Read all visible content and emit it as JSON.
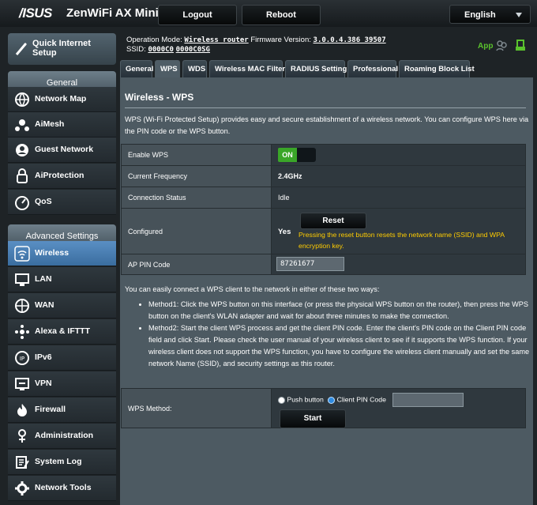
{
  "header": {
    "brand": "/ISUS",
    "model": "ZenWiFi AX Mini",
    "logout_label": "Logout",
    "reboot_label": "Reboot",
    "language": "English",
    "operation_mode_label": "Operation Mode:",
    "operation_mode": "Wireless router",
    "firmware_label": "Firmware Version:",
    "firmware_version": "3.0.0.4.386_39507",
    "ssid_label": "SSID:",
    "ssid_1": "0000C0",
    "ssid_2": "0000C0SG",
    "app_label": "App"
  },
  "sidebar": {
    "qis_label": "Quick Internet Setup",
    "general_head": "General",
    "general_items": [
      {
        "label": "Network Map",
        "icon": "globe-icon"
      },
      {
        "label": "AiMesh",
        "icon": "mesh-icon"
      },
      {
        "label": "Guest Network",
        "icon": "guest-icon"
      },
      {
        "label": "AiProtection",
        "icon": "lock-icon"
      },
      {
        "label": "QoS",
        "icon": "gauge-icon"
      }
    ],
    "advanced_head": "Advanced Settings",
    "advanced_items": [
      {
        "label": "Wireless",
        "icon": "wifi-icon"
      },
      {
        "label": "LAN",
        "icon": "monitor-icon"
      },
      {
        "label": "WAN",
        "icon": "globe-icon"
      },
      {
        "label": "Alexa & IFTTT",
        "icon": "dots-icon"
      },
      {
        "label": "IPv6",
        "icon": "ipv6-icon"
      },
      {
        "label": "VPN",
        "icon": "vpn-icon"
      },
      {
        "label": "Firewall",
        "icon": "fire-icon"
      },
      {
        "label": "Administration",
        "icon": "admin-icon"
      },
      {
        "label": "System Log",
        "icon": "log-icon"
      },
      {
        "label": "Network Tools",
        "icon": "tools-icon"
      }
    ]
  },
  "tabs": [
    "General",
    "WPS",
    "WDS",
    "Wireless MAC Filter",
    "RADIUS Setting",
    "Professional",
    "Roaming Block List"
  ],
  "active_tab": "WPS",
  "page": {
    "title": "Wireless - WPS",
    "description": "WPS (Wi-Fi Protected Setup) provides easy and secure establishment of a wireless network. You can configure WPS here via the PIN code or the WPS button.",
    "rows": {
      "enable_wps": {
        "label": "Enable WPS",
        "value": "ON"
      },
      "frequency": {
        "label": "Current Frequency",
        "value": "2.4GHz"
      },
      "connection_status": {
        "label": "Connection Status",
        "value": "Idle"
      },
      "configured": {
        "label": "Configured",
        "value": "Yes",
        "button": "Reset",
        "note": "Pressing the reset button resets the network name (SSID) and WPA encryption key."
      },
      "ap_pin": {
        "label": "AP PIN Code",
        "value": "87261677"
      }
    },
    "ways_intro": "You can easily connect a WPS client to the network in either of these two ways:",
    "method1": "Method1: Click the WPS button on this interface (or press the physical WPS button on the router), then press the WPS button on the client's WLAN adapter and wait for about three minutes to make the connection.",
    "method2": "Method2: Start the client WPS process and get the client PIN code. Enter the client's PIN code on the Client PIN code field and click Start. Please check the user manual of your wireless client to see if it supports the WPS function. If your wireless client does not support the WPS function, you have to configure the wireless client manually and set the same network Name (SSID), and security settings as this router.",
    "wps_method_label": "WPS Method:",
    "push_button_label": "Push button",
    "client_pin_label": "Client PIN Code",
    "start_label": "Start"
  },
  "colors": {
    "accent_green": "#3aa628",
    "highlight_yellow": "#ffcc00",
    "active_blue": "#3a6d9f"
  }
}
